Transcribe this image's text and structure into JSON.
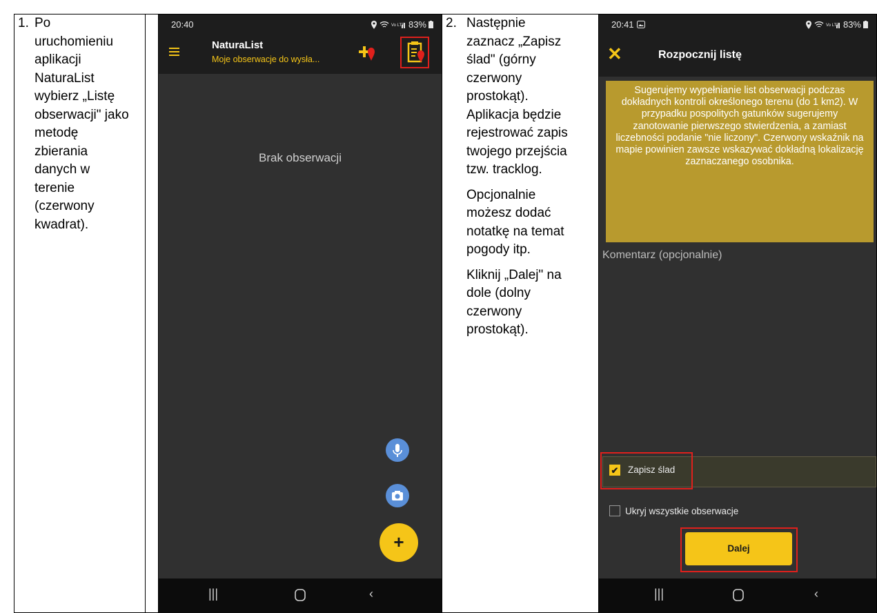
{
  "step1": {
    "number": "1.",
    "lines": [
      "Po",
      "uruchomieniu",
      "aplikacji",
      "NaturaList",
      "wybierz „Listę",
      "obserwacji\" jako",
      "metodę",
      "zbierania",
      "danych w",
      "terenie",
      "(czerwony",
      "kwadrat)."
    ]
  },
  "step2": {
    "number": "2.",
    "para1": [
      "Następnie",
      "zaznacz „Zapisz",
      "ślad\" (górny",
      "czerwony",
      "prostokąt).",
      "Aplikacja będzie",
      "rejestrować zapis",
      "twojego przejścia",
      "tzw. tracklog."
    ],
    "para2": [
      "Opcjonalnie",
      "możesz dodać",
      "notatkę na temat",
      "pogody itp."
    ],
    "para3": [
      "Kliknij „Dalej\" na",
      "dole (dolny",
      "czerwony",
      "prostokąt)."
    ]
  },
  "phone1": {
    "status": {
      "time": "20:40",
      "battery": "83%"
    },
    "appbar": {
      "title": "NaturaList",
      "subtitle": "Moje obserwacje do wysła..."
    },
    "empty_text": "Brak obserwacji",
    "fab_add_label": "+",
    "icons": [
      "menu-icon",
      "add-observation-icon",
      "list-icon",
      "mic-icon",
      "camera-icon"
    ]
  },
  "phone2": {
    "status": {
      "time": "20:41",
      "battery": "83%"
    },
    "title": "Rozpocznij listę",
    "close_label": "✕",
    "info_text": "Sugerujemy wypełnianie list obserwacji podczas dokładnych kontroli określonego terenu (do 1 km2). W przypadku pospolitych gatunków sugerujemy zanotowanie pierwszego stwierdzenia, a zamiast liczebności podanie \"nie liczony\". Czerwony wskaźnik na mapie powinien zawsze wskazywać dokładną lokalizację zaznaczanego osobnika.",
    "comment_placeholder": "Komentarz (opcjonalnie)",
    "save_track": {
      "label": "Zapisz ślad",
      "checked": true,
      "mark": "✔"
    },
    "hide_all": {
      "label": "Ukryj wszystkie obserwacje",
      "checked": false
    },
    "next_button": "Dalej"
  },
  "colors": {
    "accent": "#f5c518",
    "highlight": "#e0201c",
    "info_bg": "#b89a2e",
    "fab_blue": "#5a8fd8"
  }
}
